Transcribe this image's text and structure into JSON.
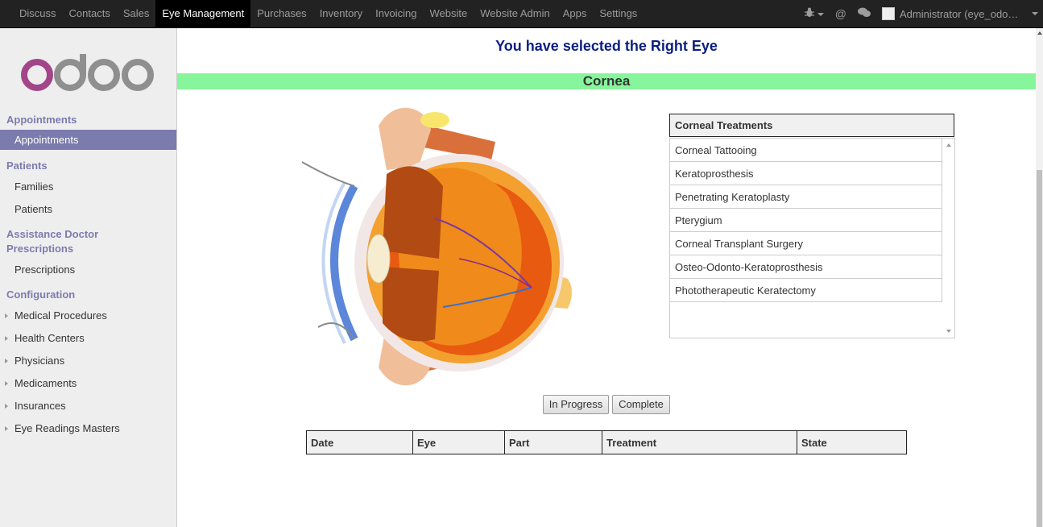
{
  "nav": {
    "items": [
      "Discuss",
      "Contacts",
      "Sales",
      "Eye Management",
      "Purchases",
      "Inventory",
      "Invoicing",
      "Website",
      "Website Admin",
      "Apps",
      "Settings"
    ],
    "active": "Eye Management",
    "user": "Administrator (eye_odo…",
    "icons": [
      "bug-icon",
      "at-icon",
      "chat-icon"
    ]
  },
  "sidebar": {
    "logo_text": "odoo",
    "sections": [
      {
        "title": "Appointments",
        "items": [
          {
            "label": "Appointments",
            "active": true
          }
        ]
      },
      {
        "title": "Patients",
        "items": [
          {
            "label": "Families"
          },
          {
            "label": "Patients"
          }
        ]
      },
      {
        "title": "Assistance Doctor Prescriptions",
        "items": [
          {
            "label": "Prescriptions"
          }
        ]
      },
      {
        "title": "Configuration",
        "items": [
          {
            "label": "Medical Procedures",
            "expandable": true
          },
          {
            "label": "Health Centers",
            "expandable": true
          },
          {
            "label": "Physicians",
            "expandable": true
          },
          {
            "label": "Medicaments",
            "expandable": true
          },
          {
            "label": "Insurances",
            "expandable": true
          },
          {
            "label": "Eye Readings Masters",
            "expandable": true
          }
        ]
      }
    ]
  },
  "main": {
    "heading": "You have selected the Right Eye",
    "part_title": "Cornea",
    "treatments_header": "Corneal Treatments",
    "treatments": [
      "Corneal Tattooing",
      "Keratoprosthesis",
      "Penetrating Keratoplasty",
      "Pterygium",
      "Corneal Transplant Surgery",
      "Osteo-Odonto-Keratoprosthesis",
      "Phototherapeutic Keratectomy"
    ],
    "buttons": {
      "in_progress": "In Progress",
      "complete": "Complete"
    },
    "table_headers": [
      "Date",
      "Eye",
      "Part",
      "Treatment",
      "State"
    ]
  },
  "colors": {
    "accent": "#7c7bad",
    "heading": "#0a1e82",
    "band": "#87f59b",
    "navbar": "#222222"
  }
}
